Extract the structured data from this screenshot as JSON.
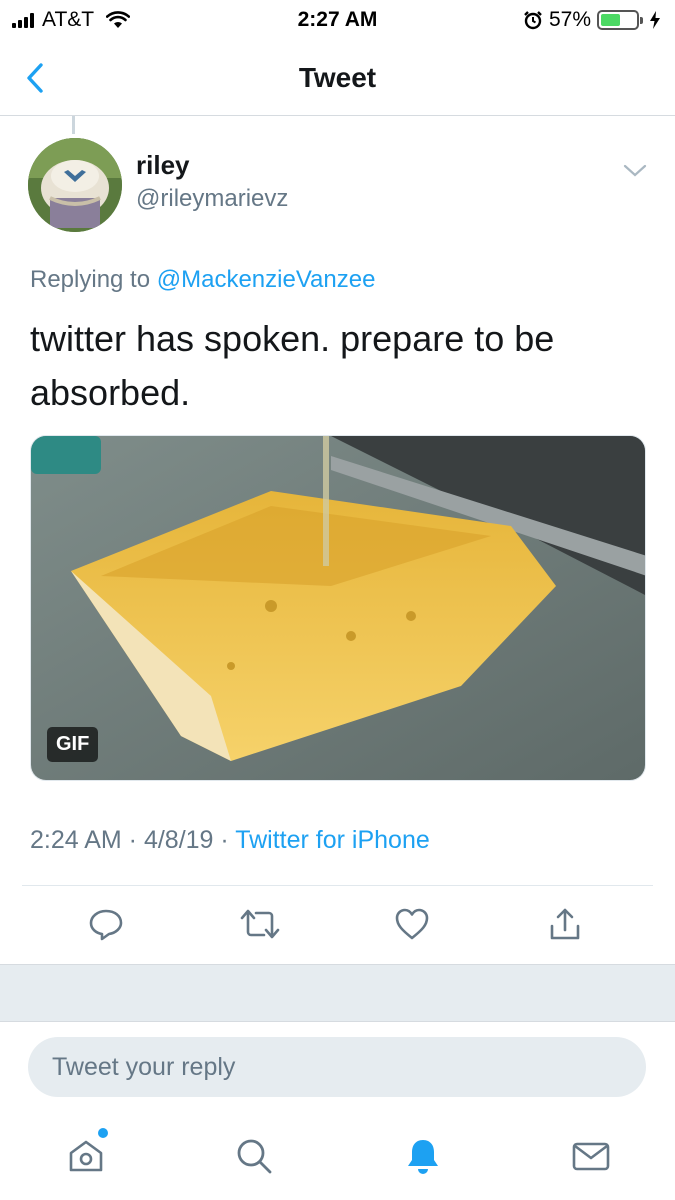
{
  "status_bar": {
    "carrier": "AT&T",
    "time": "2:27 AM",
    "battery_percent": "57%",
    "battery_level": 0.57,
    "icons": [
      "signal-icon",
      "wifi-icon",
      "alarm-icon",
      "battery-icon",
      "charging-icon"
    ]
  },
  "nav": {
    "title": "Tweet",
    "back_icon": "back-chevron-icon"
  },
  "tweet": {
    "author_name": "riley",
    "author_handle": "@rileymarievz",
    "replying_prefix": "Replying to",
    "replying_to": "@MackenzieVanzee",
    "text": "twitter has spoken. prepare to be absorbed.",
    "media_badge": "GIF",
    "time": "2:24 AM",
    "separator1": " · ",
    "date": "4/8/19",
    "separator2": " · ",
    "source": "Twitter for iPhone"
  },
  "actions": {
    "icons": [
      "reply-icon",
      "retweet-icon",
      "like-icon",
      "share-icon"
    ]
  },
  "reply": {
    "placeholder": "Tweet your reply"
  },
  "tab_bar": {
    "icons": [
      "home-icon",
      "search-icon",
      "notifications-icon",
      "messages-icon"
    ],
    "active": "notifications-icon",
    "accent": "#1da1f2"
  },
  "colors": {
    "accent": "#1da1f2",
    "secondary_text": "#657786",
    "primary_text": "#14171a"
  }
}
